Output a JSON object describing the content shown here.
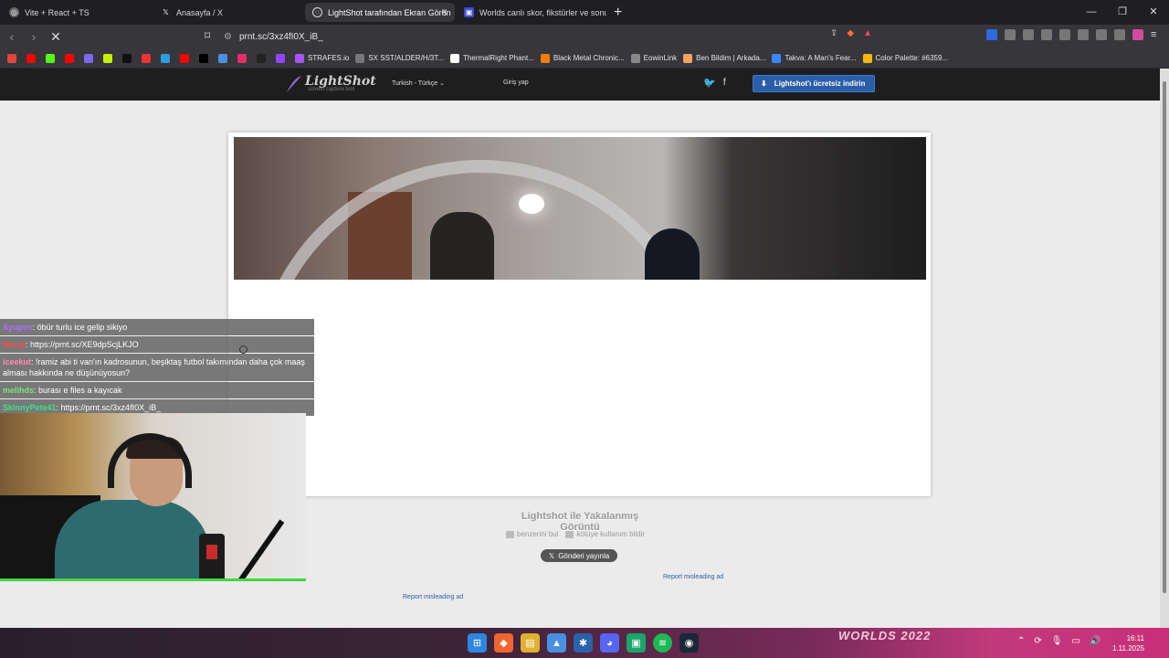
{
  "tabs": [
    {
      "title": "Vite + React + TS",
      "icon": "globe-icon",
      "active": false
    },
    {
      "title": "Anasayfa / X",
      "icon": "x-logo-icon",
      "active": false
    },
    {
      "title": "LightShot tarafından Ekran Görün",
      "icon": "lightshot-icon",
      "active": true
    },
    {
      "title": "Worlds canlı skor, fikstürler ve sonuç",
      "icon": "worlds-icon",
      "active": false
    }
  ],
  "toolbar": {
    "url": "prnt.sc/3xz4fI0X_iB_"
  },
  "bookmarks": [
    {
      "label": "",
      "color": "#e0463a"
    },
    {
      "label": "",
      "color": "#ff0000"
    },
    {
      "label": "",
      "color": "#53fc18"
    },
    {
      "label": "",
      "color": "#ff0000"
    },
    {
      "label": "",
      "color": "#7b68ee"
    },
    {
      "label": "",
      "color": "#c7f000"
    },
    {
      "label": "",
      "color": "#111111"
    },
    {
      "label": "",
      "color": "#e33"
    },
    {
      "label": "",
      "color": "#2d9cdb"
    },
    {
      "label": "",
      "color": "#ff0000"
    },
    {
      "label": "",
      "color": "#000000"
    },
    {
      "label": "",
      "color": "#4a90e2"
    },
    {
      "label": "",
      "color": "#e1306c"
    },
    {
      "label": "",
      "color": "#222222"
    },
    {
      "label": "",
      "color": "#9146ff"
    },
    {
      "label": "STRAFES.io",
      "color": "#a855f7"
    },
    {
      "label": "SX SST/ALDER/H/3T...",
      "color": "#777777"
    },
    {
      "label": "ThermalRight Phant...",
      "color": "#ffffff"
    },
    {
      "label": "Black Metal Chronic...",
      "color": "#f57c00"
    },
    {
      "label": "EowinLink",
      "color": "#888888"
    },
    {
      "label": "Ben Bildim | Arkada...",
      "color": "#f4a261"
    },
    {
      "label": "Takva: A Man's Fear...",
      "color": "#3a86ff"
    },
    {
      "label": "Color Palette: #6359...",
      "color": "#ffb703"
    }
  ],
  "lightshot": {
    "logo": "LightShot",
    "tagline": "screen capture tool",
    "language": "Turkish - Türkçe",
    "login": "Giriş yap",
    "download": "Lightshot'ı ücretsiz indirin",
    "caption": "Lightshot ile Yakalanmış Görüntü",
    "find_similar": "benzerini bul",
    "report_abuse": "kötüye kullanım bildir",
    "tweet": "Gönderi yayınla",
    "misleading_ad_1": "Report misleading ad",
    "misleading_ad_2": "Report misleading ad"
  },
  "chat": [
    {
      "user": "Ayupos",
      "color": "#b36bff",
      "text": ": öbür turlu ice gelip sikiyo"
    },
    {
      "user": "Nervy",
      "color": "#ff4a4a",
      "text": ": https://prnt.sc/XE9dpScjLKJO"
    },
    {
      "user": "iceekut",
      "color": "#ff8ab0",
      "text": ": !ramiz abi ti van'ın kadrosunun, beşiktaş futbol takımından daha çok maaş alması hakkında ne düşünüyosun?"
    },
    {
      "user": "melihds",
      "color": "#7ee07e",
      "text": ": burası e files a kayıcak"
    },
    {
      "user": "SkinnyPete41",
      "color": "#3ee08a",
      "text": ": https://prnt.sc/3xz4fI0X_iB_"
    }
  ],
  "taskbar": {
    "banner": "WORLDS 2022",
    "time": "16:11",
    "date": "1.11.2025"
  }
}
